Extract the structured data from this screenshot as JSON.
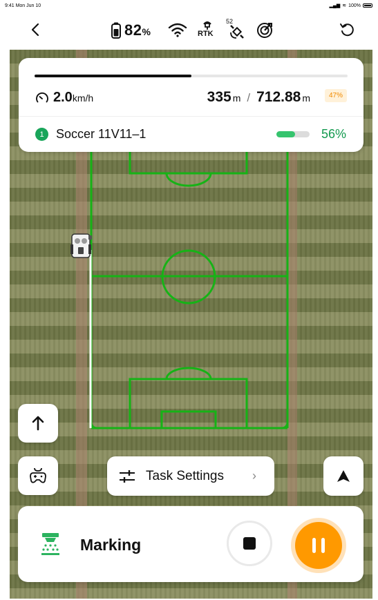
{
  "status_bar": {
    "time": "9:41  Mon Jun 10",
    "battery_text": "100%"
  },
  "top_bar": {
    "battery_percent": "82",
    "battery_unit": "%",
    "rtk_label": "RTK",
    "satellite_count": "52",
    "icons": [
      "back-icon",
      "battery-icon",
      "wifi-icon",
      "rtk-icon",
      "satellite-icon",
      "target-icon",
      "refresh-icon"
    ]
  },
  "progress": {
    "fraction": 0.5
  },
  "speed": {
    "value": "2.0",
    "unit": "km/h"
  },
  "distance": {
    "done": "335",
    "done_unit": "m",
    "separator": "/",
    "total": "712.88",
    "total_unit": "m",
    "percent": "47%"
  },
  "task": {
    "number": "1",
    "name": "Soccer 11V11–1",
    "percent": "56%",
    "fraction": 0.56
  },
  "task_settings": {
    "label": "Task Settings",
    "chevron": "›"
  },
  "bottom": {
    "mode_label": "Marking"
  },
  "colors": {
    "field_line": "#16b316",
    "accent_orange": "#ff9900",
    "accent_green": "#19a55a"
  }
}
